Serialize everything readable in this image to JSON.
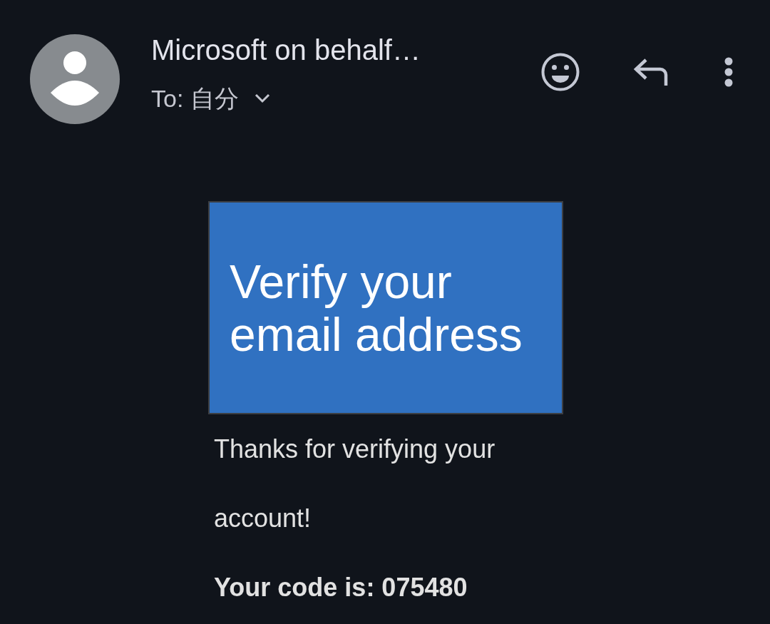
{
  "sender": {
    "name": "Microsoft on behalf…",
    "recipient": "To: 自分"
  },
  "banner": {
    "title": "Verify your email address"
  },
  "body": {
    "message": "Thanks for verifying your account!",
    "code_line": "Your code is: 075480"
  }
}
